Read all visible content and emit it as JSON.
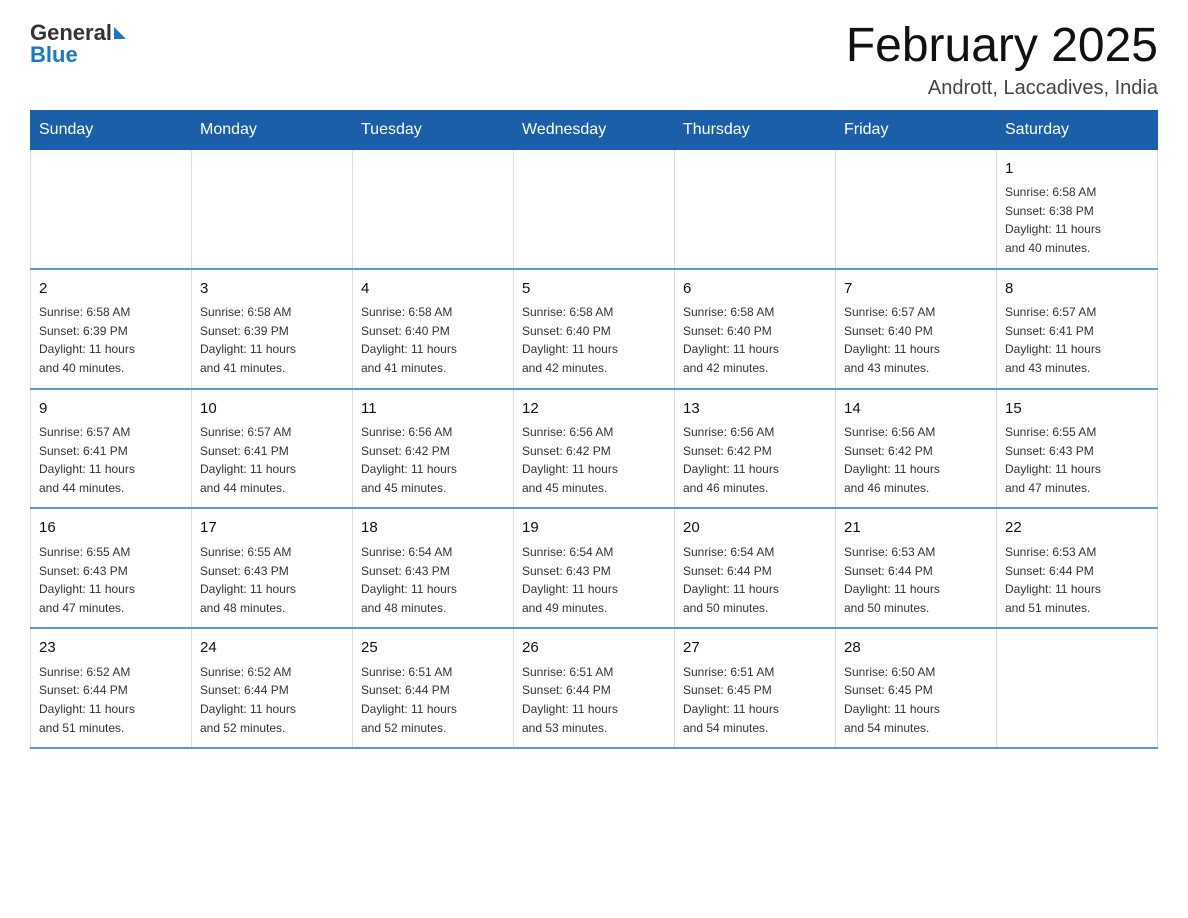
{
  "header": {
    "logo_general": "General",
    "logo_blue": "Blue",
    "month_title": "February 2025",
    "location": "Andrott, Laccadives, India"
  },
  "weekdays": [
    "Sunday",
    "Monday",
    "Tuesday",
    "Wednesday",
    "Thursday",
    "Friday",
    "Saturday"
  ],
  "weeks": [
    [
      {
        "day": "",
        "info": ""
      },
      {
        "day": "",
        "info": ""
      },
      {
        "day": "",
        "info": ""
      },
      {
        "day": "",
        "info": ""
      },
      {
        "day": "",
        "info": ""
      },
      {
        "day": "",
        "info": ""
      },
      {
        "day": "1",
        "info": "Sunrise: 6:58 AM\nSunset: 6:38 PM\nDaylight: 11 hours\nand 40 minutes."
      }
    ],
    [
      {
        "day": "2",
        "info": "Sunrise: 6:58 AM\nSunset: 6:39 PM\nDaylight: 11 hours\nand 40 minutes."
      },
      {
        "day": "3",
        "info": "Sunrise: 6:58 AM\nSunset: 6:39 PM\nDaylight: 11 hours\nand 41 minutes."
      },
      {
        "day": "4",
        "info": "Sunrise: 6:58 AM\nSunset: 6:40 PM\nDaylight: 11 hours\nand 41 minutes."
      },
      {
        "day": "5",
        "info": "Sunrise: 6:58 AM\nSunset: 6:40 PM\nDaylight: 11 hours\nand 42 minutes."
      },
      {
        "day": "6",
        "info": "Sunrise: 6:58 AM\nSunset: 6:40 PM\nDaylight: 11 hours\nand 42 minutes."
      },
      {
        "day": "7",
        "info": "Sunrise: 6:57 AM\nSunset: 6:40 PM\nDaylight: 11 hours\nand 43 minutes."
      },
      {
        "day": "8",
        "info": "Sunrise: 6:57 AM\nSunset: 6:41 PM\nDaylight: 11 hours\nand 43 minutes."
      }
    ],
    [
      {
        "day": "9",
        "info": "Sunrise: 6:57 AM\nSunset: 6:41 PM\nDaylight: 11 hours\nand 44 minutes."
      },
      {
        "day": "10",
        "info": "Sunrise: 6:57 AM\nSunset: 6:41 PM\nDaylight: 11 hours\nand 44 minutes."
      },
      {
        "day": "11",
        "info": "Sunrise: 6:56 AM\nSunset: 6:42 PM\nDaylight: 11 hours\nand 45 minutes."
      },
      {
        "day": "12",
        "info": "Sunrise: 6:56 AM\nSunset: 6:42 PM\nDaylight: 11 hours\nand 45 minutes."
      },
      {
        "day": "13",
        "info": "Sunrise: 6:56 AM\nSunset: 6:42 PM\nDaylight: 11 hours\nand 46 minutes."
      },
      {
        "day": "14",
        "info": "Sunrise: 6:56 AM\nSunset: 6:42 PM\nDaylight: 11 hours\nand 46 minutes."
      },
      {
        "day": "15",
        "info": "Sunrise: 6:55 AM\nSunset: 6:43 PM\nDaylight: 11 hours\nand 47 minutes."
      }
    ],
    [
      {
        "day": "16",
        "info": "Sunrise: 6:55 AM\nSunset: 6:43 PM\nDaylight: 11 hours\nand 47 minutes."
      },
      {
        "day": "17",
        "info": "Sunrise: 6:55 AM\nSunset: 6:43 PM\nDaylight: 11 hours\nand 48 minutes."
      },
      {
        "day": "18",
        "info": "Sunrise: 6:54 AM\nSunset: 6:43 PM\nDaylight: 11 hours\nand 48 minutes."
      },
      {
        "day": "19",
        "info": "Sunrise: 6:54 AM\nSunset: 6:43 PM\nDaylight: 11 hours\nand 49 minutes."
      },
      {
        "day": "20",
        "info": "Sunrise: 6:54 AM\nSunset: 6:44 PM\nDaylight: 11 hours\nand 50 minutes."
      },
      {
        "day": "21",
        "info": "Sunrise: 6:53 AM\nSunset: 6:44 PM\nDaylight: 11 hours\nand 50 minutes."
      },
      {
        "day": "22",
        "info": "Sunrise: 6:53 AM\nSunset: 6:44 PM\nDaylight: 11 hours\nand 51 minutes."
      }
    ],
    [
      {
        "day": "23",
        "info": "Sunrise: 6:52 AM\nSunset: 6:44 PM\nDaylight: 11 hours\nand 51 minutes."
      },
      {
        "day": "24",
        "info": "Sunrise: 6:52 AM\nSunset: 6:44 PM\nDaylight: 11 hours\nand 52 minutes."
      },
      {
        "day": "25",
        "info": "Sunrise: 6:51 AM\nSunset: 6:44 PM\nDaylight: 11 hours\nand 52 minutes."
      },
      {
        "day": "26",
        "info": "Sunrise: 6:51 AM\nSunset: 6:44 PM\nDaylight: 11 hours\nand 53 minutes."
      },
      {
        "day": "27",
        "info": "Sunrise: 6:51 AM\nSunset: 6:45 PM\nDaylight: 11 hours\nand 54 minutes."
      },
      {
        "day": "28",
        "info": "Sunrise: 6:50 AM\nSunset: 6:45 PM\nDaylight: 11 hours\nand 54 minutes."
      },
      {
        "day": "",
        "info": ""
      }
    ]
  ]
}
